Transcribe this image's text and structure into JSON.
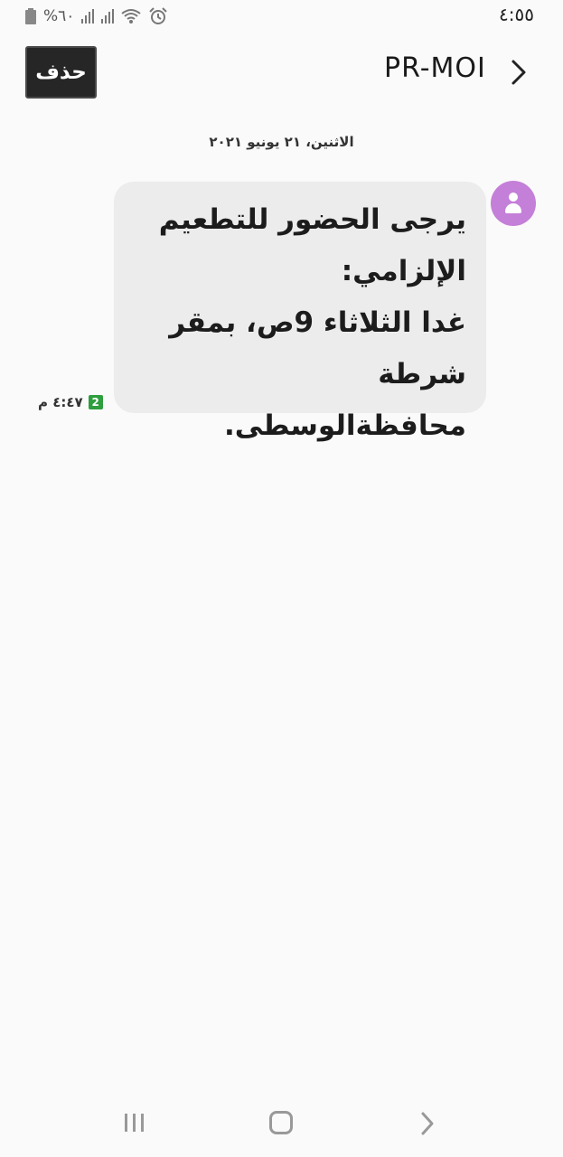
{
  "status_bar": {
    "time": "٤:٥٥",
    "battery": "%٦٠",
    "icons": [
      "battery-icon",
      "signal-icon",
      "signal-icon",
      "wifi-icon",
      "alarm-icon"
    ]
  },
  "header": {
    "delete_label": "حذف",
    "sender": "PR-MOI",
    "back_icon": "chevron-right-icon"
  },
  "conversation": {
    "date": "الاثنين، ٢١ يونيو ٢٠٢١",
    "messages": [
      {
        "text": "يرجى الحضور للتطعيم\nالإلزامي:\nغدا الثلاثاء 9ص، بمقر\nشرطة محافظةالوسطى.",
        "time": "٤:٤٧ م",
        "sim": "2"
      }
    ]
  },
  "nav_bar": {
    "icons": [
      "recents-icon",
      "home-icon",
      "back-icon"
    ]
  },
  "colors": {
    "background": "#fafafa",
    "bubble": "#ececec",
    "avatar": "#c47fd8",
    "delete_button": "#262626",
    "sim_badge": "#2e9e3e"
  }
}
